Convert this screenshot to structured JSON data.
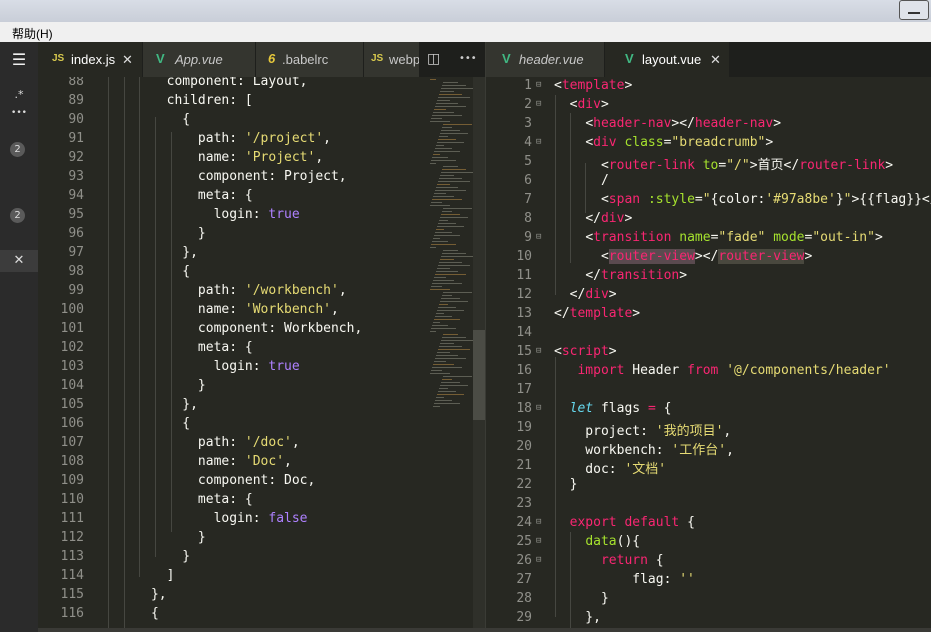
{
  "menubar": {
    "help": "帮助(H)"
  },
  "activity": {
    "explorer_label": "✕",
    "search_label": ".*",
    "more_label": "•••",
    "badge1": "2",
    "badge2": "2",
    "close_label": "✕"
  },
  "left_tabs": [
    {
      "icon": "JS",
      "label": "index.js",
      "close": "✕"
    },
    {
      "icon": "V",
      "label": "App.vue"
    },
    {
      "icon": "6",
      "label": ".babelrc"
    },
    {
      "icon": "JS",
      "label": "webp"
    }
  ],
  "left_actions": {
    "split": "◫",
    "more": "•••"
  },
  "right_tabs": [
    {
      "icon": "V",
      "label": "header.vue"
    },
    {
      "icon": "V",
      "label": "layout.vue",
      "close": "✕"
    }
  ],
  "left_code": {
    "line_numbers": [
      "88",
      "89",
      "90",
      "91",
      "92",
      "93",
      "94",
      "95",
      "96",
      "97",
      "98",
      "99",
      "100",
      "101",
      "102",
      "103",
      "104",
      "105",
      "106",
      "107",
      "108",
      "109",
      "110",
      "111",
      "112",
      "113",
      "114",
      "115",
      "116"
    ],
    "lines": [
      [
        [
          "t",
          "        component: Layout,"
        ]
      ],
      [
        [
          "t",
          "        children: ["
        ]
      ],
      [
        [
          "t",
          "          {"
        ]
      ],
      [
        [
          "t",
          "            path: "
        ],
        [
          "str",
          "'/project'"
        ],
        [
          "t",
          ","
        ]
      ],
      [
        [
          "t",
          "            name: "
        ],
        [
          "str",
          "'Project'"
        ],
        [
          "t",
          ","
        ]
      ],
      [
        [
          "t",
          "            component: Project,"
        ]
      ],
      [
        [
          "t",
          "            meta: {"
        ]
      ],
      [
        [
          "t",
          "              login: "
        ],
        [
          "bool",
          "true"
        ]
      ],
      [
        [
          "t",
          "            }"
        ]
      ],
      [
        [
          "t",
          "          },"
        ]
      ],
      [
        [
          "t",
          "          {"
        ]
      ],
      [
        [
          "t",
          "            path: "
        ],
        [
          "str",
          "'/workbench'"
        ],
        [
          "t",
          ","
        ]
      ],
      [
        [
          "t",
          "            name: "
        ],
        [
          "str",
          "'Workbench'"
        ],
        [
          "t",
          ","
        ]
      ],
      [
        [
          "t",
          "            component: Workbench,"
        ]
      ],
      [
        [
          "t",
          "            meta: {"
        ]
      ],
      [
        [
          "t",
          "              login: "
        ],
        [
          "bool",
          "true"
        ]
      ],
      [
        [
          "t",
          "            }"
        ]
      ],
      [
        [
          "t",
          "          },"
        ]
      ],
      [
        [
          "t",
          "          {"
        ]
      ],
      [
        [
          "t",
          "            path: "
        ],
        [
          "str",
          "'/doc'"
        ],
        [
          "t",
          ","
        ]
      ],
      [
        [
          "t",
          "            name: "
        ],
        [
          "str",
          "'Doc'"
        ],
        [
          "t",
          ","
        ]
      ],
      [
        [
          "t",
          "            component: Doc,"
        ]
      ],
      [
        [
          "t",
          "            meta: {"
        ]
      ],
      [
        [
          "t",
          "              login: "
        ],
        [
          "bool",
          "false"
        ]
      ],
      [
        [
          "t",
          "            }"
        ]
      ],
      [
        [
          "t",
          "          }"
        ]
      ],
      [
        [
          "t",
          "        ]"
        ]
      ],
      [
        [
          "t",
          "      },"
        ]
      ],
      [
        [
          "t",
          "      {"
        ]
      ]
    ]
  },
  "right_code": {
    "line_numbers": [
      "1",
      "2",
      "3",
      "4",
      "5",
      "6",
      "7",
      "8",
      "9",
      "10",
      "11",
      "12",
      "13",
      "14",
      "15",
      "16",
      "17",
      "18",
      "19",
      "20",
      "21",
      "22",
      "23",
      "24",
      "25",
      "26",
      "27",
      "28",
      "29"
    ],
    "fold_lines": [
      0,
      1,
      3,
      8,
      14,
      17,
      23,
      24,
      25
    ],
    "lines": [
      [
        [
          "punct",
          "<"
        ],
        [
          "tag",
          "template"
        ],
        [
          "punct",
          ">"
        ]
      ],
      [
        [
          "t",
          "  "
        ],
        [
          "punct",
          "<"
        ],
        [
          "tag",
          "div"
        ],
        [
          "punct",
          ">"
        ]
      ],
      [
        [
          "t",
          "    "
        ],
        [
          "punct",
          "<"
        ],
        [
          "tag",
          "header-nav"
        ],
        [
          "punct",
          "></"
        ],
        [
          "tag",
          "header-nav"
        ],
        [
          "punct",
          ">"
        ]
      ],
      [
        [
          "t",
          "    "
        ],
        [
          "punct",
          "<"
        ],
        [
          "tag",
          "div"
        ],
        [
          "t",
          " "
        ],
        [
          "attr",
          "class"
        ],
        [
          "punct",
          "="
        ],
        [
          "str",
          "\"breadcrumb\""
        ],
        [
          "punct",
          ">"
        ]
      ],
      [
        [
          "t",
          "      "
        ],
        [
          "punct",
          "<"
        ],
        [
          "tag",
          "router-link"
        ],
        [
          "t",
          " "
        ],
        [
          "attr",
          "to"
        ],
        [
          "punct",
          "="
        ],
        [
          "str",
          "\"/\""
        ],
        [
          "punct",
          ">"
        ],
        [
          "t",
          "首页"
        ],
        [
          "punct",
          "</"
        ],
        [
          "tag",
          "router-link"
        ],
        [
          "punct",
          ">"
        ]
      ],
      [
        [
          "t",
          "      /"
        ]
      ],
      [
        [
          "t",
          "      "
        ],
        [
          "punct",
          "<"
        ],
        [
          "tag",
          "span"
        ],
        [
          "t",
          " "
        ],
        [
          "attr",
          ":style"
        ],
        [
          "punct",
          "="
        ],
        [
          "str",
          "\""
        ],
        [
          "t",
          "{color:"
        ],
        [
          "str",
          "'#97a8be'"
        ],
        [
          "t",
          "}"
        ],
        [
          "str",
          "\""
        ],
        [
          "punct",
          ">"
        ],
        [
          "t",
          "{{flag}}</"
        ]
      ],
      [
        [
          "t",
          "    "
        ],
        [
          "punct",
          "</"
        ],
        [
          "tag",
          "div"
        ],
        [
          "punct",
          ">"
        ]
      ],
      [
        [
          "t",
          "    "
        ],
        [
          "punct",
          "<"
        ],
        [
          "tag",
          "transition"
        ],
        [
          "t",
          " "
        ],
        [
          "attr",
          "name"
        ],
        [
          "punct",
          "="
        ],
        [
          "str",
          "\"fade\""
        ],
        [
          "t",
          " "
        ],
        [
          "attr",
          "mode"
        ],
        [
          "punct",
          "="
        ],
        [
          "str",
          "\"out-in\""
        ],
        [
          "punct",
          ">"
        ]
      ],
      [
        [
          "t",
          "      "
        ],
        [
          "punct",
          "<"
        ],
        [
          "hltag",
          "router-view"
        ],
        [
          "punct",
          "></"
        ],
        [
          "hltag2",
          "router-view"
        ],
        [
          "punct",
          ">"
        ]
      ],
      [
        [
          "t",
          "    "
        ],
        [
          "punct",
          "</"
        ],
        [
          "tag",
          "transition"
        ],
        [
          "punct",
          ">"
        ]
      ],
      [
        [
          "t",
          "  "
        ],
        [
          "punct",
          "</"
        ],
        [
          "tag",
          "div"
        ],
        [
          "punct",
          ">"
        ]
      ],
      [
        [
          "punct",
          "</"
        ],
        [
          "tag",
          "template"
        ],
        [
          "punct",
          ">"
        ]
      ],
      [
        [
          "t",
          ""
        ]
      ],
      [
        [
          "punct",
          "<"
        ],
        [
          "tag",
          "script"
        ],
        [
          "punct",
          ">"
        ]
      ],
      [
        [
          "t",
          "   "
        ],
        [
          "kw",
          "import"
        ],
        [
          "t",
          " Header "
        ],
        [
          "kw",
          "from"
        ],
        [
          "t",
          " "
        ],
        [
          "str",
          "'@/components/header'"
        ]
      ],
      [
        [
          "t",
          ""
        ]
      ],
      [
        [
          "t",
          "  "
        ],
        [
          "var",
          "let"
        ],
        [
          "t",
          " flags "
        ],
        [
          "kw",
          "="
        ],
        [
          "t",
          " {"
        ]
      ],
      [
        [
          "t",
          "    project: "
        ],
        [
          "str",
          "'我的项目'"
        ],
        [
          "t",
          ","
        ]
      ],
      [
        [
          "t",
          "    workbench: "
        ],
        [
          "str",
          "'工作台'"
        ],
        [
          "t",
          ","
        ]
      ],
      [
        [
          "t",
          "    doc: "
        ],
        [
          "str",
          "'文档'"
        ]
      ],
      [
        [
          "t",
          "  }"
        ]
      ],
      [
        [
          "t",
          ""
        ]
      ],
      [
        [
          "t",
          "  "
        ],
        [
          "kw",
          "export"
        ],
        [
          "t",
          " "
        ],
        [
          "kw",
          "default"
        ],
        [
          "t",
          " {"
        ]
      ],
      [
        [
          "t",
          "    "
        ],
        [
          "fn",
          "data"
        ],
        [
          "t",
          "(){"
        ]
      ],
      [
        [
          "t",
          "      "
        ],
        [
          "kw",
          "return"
        ],
        [
          "t",
          " {"
        ]
      ],
      [
        [
          "t",
          "          flag: "
        ],
        [
          "str",
          "''"
        ]
      ],
      [
        [
          "t",
          "      }"
        ]
      ],
      [
        [
          "t",
          "    },"
        ]
      ]
    ]
  }
}
